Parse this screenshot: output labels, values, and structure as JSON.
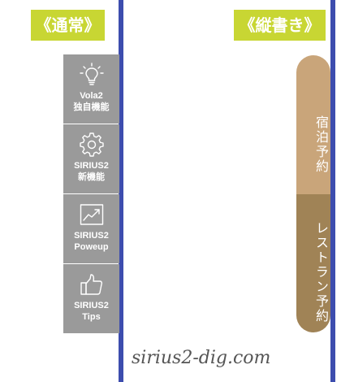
{
  "labels": {
    "normal": "《通常》",
    "vertical": "《縦書き》"
  },
  "side_menu": {
    "items": [
      {
        "icon": "lightbulb-icon",
        "line1": "Vola2",
        "line2": "独自機能"
      },
      {
        "icon": "gear-icon",
        "line1": "SIRIUS2",
        "line2": "新機能"
      },
      {
        "icon": "trending-chart-icon",
        "line1": "SIRIUS2",
        "line2": "Poweup"
      },
      {
        "icon": "thumbs-up-icon",
        "line1": "SIRIUS2",
        "line2": "Tips"
      }
    ]
  },
  "vertical_tabs": {
    "items": [
      {
        "label": "宿泊予約"
      },
      {
        "label": "レストラン予約"
      }
    ]
  },
  "watermark": "sirius2-dig.com",
  "colors": {
    "tag_bg": "#c8d633",
    "divider": "#3d4dae",
    "menu_bg": "#9a9a9a",
    "tab_light": "#c9a57a",
    "tab_dark": "#a08356"
  }
}
